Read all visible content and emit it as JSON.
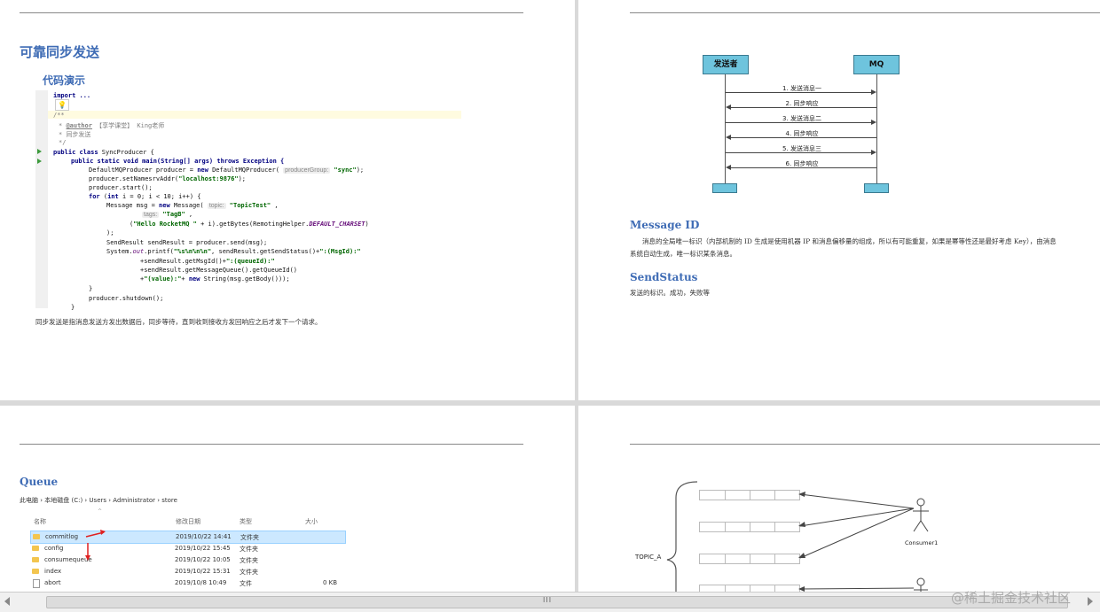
{
  "page1": {
    "title": "可靠同步发送",
    "subtitle": "代码演示",
    "code": {
      "l1_import": "import ...",
      "l2_doc": "/**",
      "l3_author_tag": "@author",
      "l3_author_val": "【享学课堂】 King老师",
      "l4": "同步发送",
      "l5": "*/",
      "l6_pub": "public class",
      "l6_name": " SyncProducer {",
      "l7": "public static void main(String[] args) throws Exception {",
      "l8a": "DefaultMQProducer producer = ",
      "l8_new": "new",
      "l8b": " DefaultMQProducer( ",
      "l8_hint": "producerGroup:",
      "l8_str": "\"sync\"",
      "l8c": ");",
      "l9a": "producer.setNamesrvAddr(",
      "l9_str": "\"localhost:9876\"",
      "l9b": ");",
      "l10": "producer.start();",
      "l11_for": "for",
      "l11_int": "int",
      "l11": " i = 0; i < 10; i++) {",
      "l12a": "Message msg = ",
      "l12_new": "new",
      "l12b": " Message( ",
      "l12_hint": "topic:",
      "l12_str": "\"TopicTest\"",
      "l12c": " ,",
      "l13_hint": "tags:",
      "l13_str": "\"TagB\"",
      "l13b": " ,",
      "l14a": "(",
      "l14_str": "\"Hello RocketMQ \"",
      "l14b": " + i).getBytes(RemotingHelper.",
      "l14_fld": "DEFAULT_CHARSET",
      "l14c": ")",
      "l15": ");",
      "l16": "SendResult sendResult = producer.send(msg);",
      "l17a": "System.",
      "l17_out": "out",
      "l17b": ".printf(",
      "l17_str": "\"%s%n%n%n\"",
      "l17c": ", sendResult.getSendStatus()+",
      "l17_str2": "\":(MsgId):\"",
      "l18a": "+sendResult.getMsgId()+",
      "l18_str": "\":(queueId):\"",
      "l19": "+sendResult.getMessageQueue().getQueueId()",
      "l20a": "+",
      "l20_str": "\"(value):\"",
      "l20b": "+ ",
      "l20_new": "new",
      "l20c": " String(msg.getBody()));",
      "l21": "}",
      "l22": "producer.shutdown();",
      "l23": "}"
    },
    "para": "同步发送是指消息发送方发出数据后，同步等待，直到收到接收方发回响应之后才发下一个请求。"
  },
  "page2": {
    "actor_left": "发送者",
    "actor_right": "MQ",
    "messages": [
      "1. 发送消息一",
      "2. 同步响应",
      "3. 发送消息二",
      "4. 同步响应",
      "5. 发送消息三",
      "6. 同步响应"
    ],
    "msgid_title": "Message ID",
    "msgid_text1": "消息的全局唯一标识（内部机制的 ID 生成是使用机器 IP 和消息偏移量的组成，所以有可能重复，如果是幂等性还是最好考虑 Key），由消息",
    "msgid_text2": "系统自动生成，唯一标识某条消息。",
    "status_title": "SendStatus",
    "status_text": "发送的标识。成功，失败等"
  },
  "page3": {
    "title": "Queue",
    "breadcrumb": "此电脑  ›  本地磁盘 (C:)  ›  Users  ›  Administrator  ›  store",
    "columns": [
      "名称",
      "修改日期",
      "类型",
      "大小"
    ],
    "rows": [
      {
        "name": "commitlog",
        "date": "2019/10/22 14:41",
        "type": "文件夹",
        "size": "",
        "kind": "folder"
      },
      {
        "name": "config",
        "date": "2019/10/22 15:45",
        "type": "文件夹",
        "size": "",
        "kind": "folder"
      },
      {
        "name": "consumequeue",
        "date": "2019/10/22 10:05",
        "type": "文件夹",
        "size": "",
        "kind": "folder"
      },
      {
        "name": "index",
        "date": "2019/10/22 15:31",
        "type": "文件夹",
        "size": "",
        "kind": "folder"
      },
      {
        "name": "abort",
        "date": "2019/10/8 10:49",
        "type": "文件",
        "size": "0 KB",
        "kind": "file"
      }
    ]
  },
  "page4": {
    "topic_label": "TOPIC_A",
    "consumer_label": "Consumer1"
  },
  "scrollbar": {
    "grip": "III"
  },
  "watermark": "@稀土掘金技术社区",
  "colors": {
    "heading": "#3f6cb5",
    "actor_box": "#6ec4dd",
    "selection": "#cce8ff",
    "folder": "#f3c54f"
  }
}
